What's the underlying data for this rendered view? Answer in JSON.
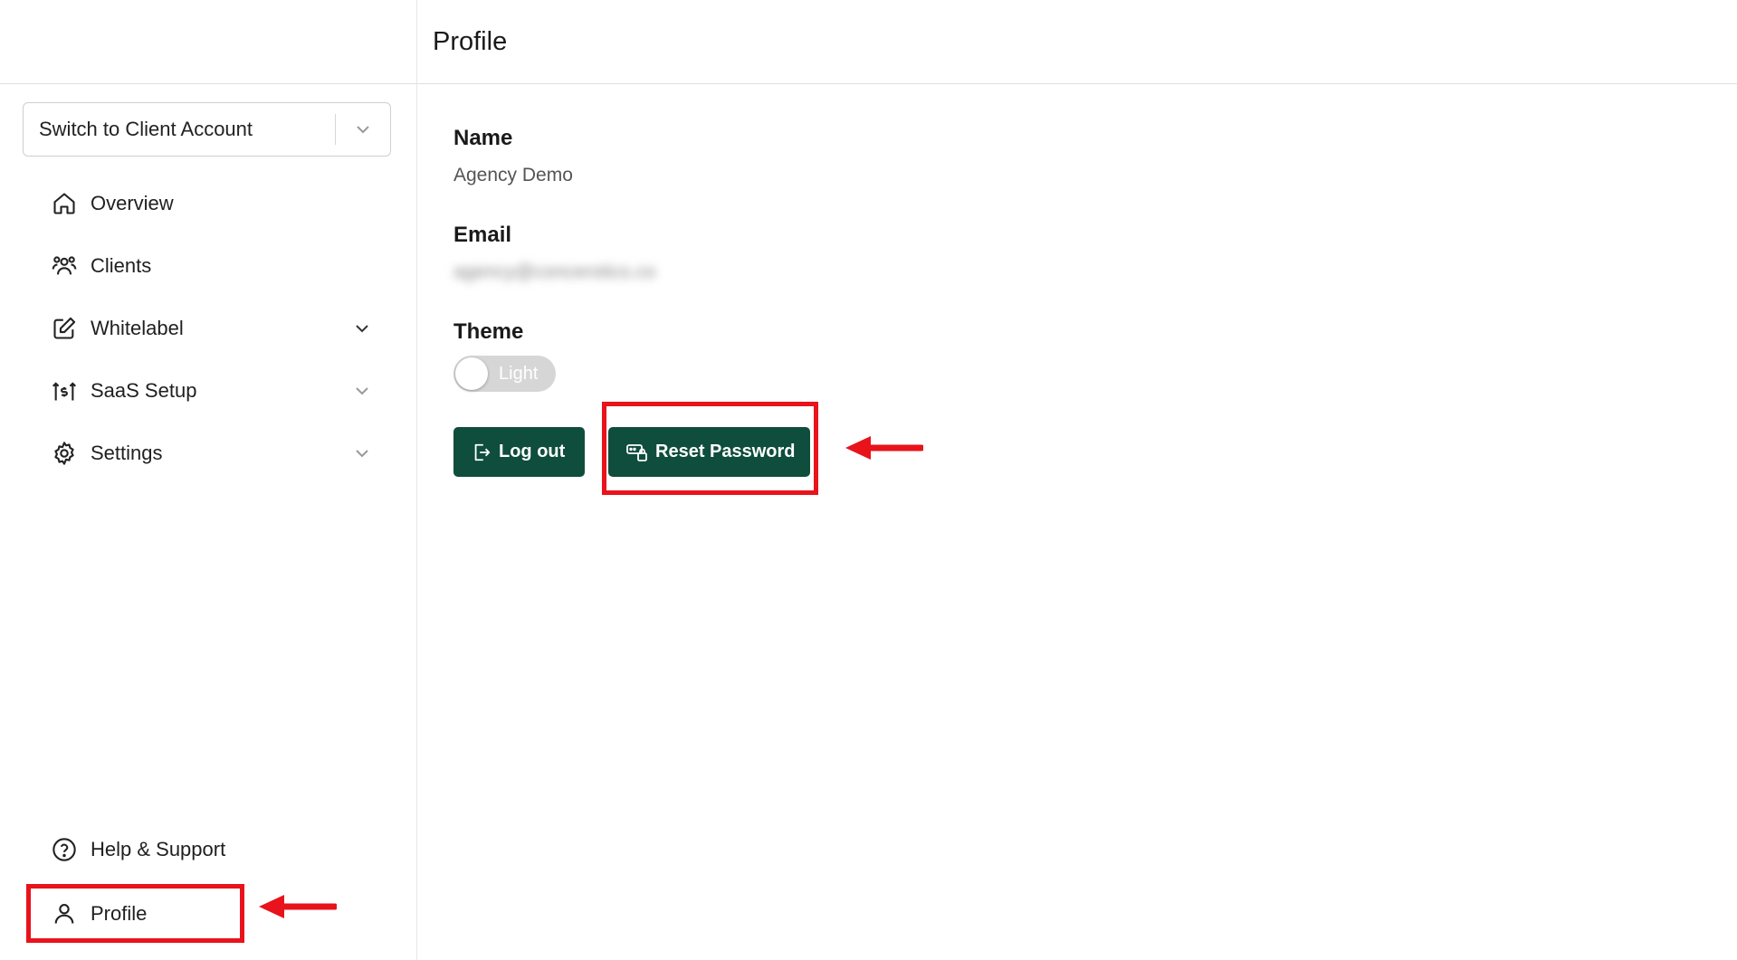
{
  "header": {
    "title": "Profile"
  },
  "sidebar": {
    "account_switch": "Switch to Client Account",
    "items": [
      {
        "label": "Overview",
        "icon": "home-icon",
        "has_chevron": false
      },
      {
        "label": "Clients",
        "icon": "users-icon",
        "has_chevron": false
      },
      {
        "label": "Whitelabel",
        "icon": "edit-icon",
        "has_chevron": true
      },
      {
        "label": "SaaS Setup",
        "icon": "saas-icon",
        "has_chevron": true
      },
      {
        "label": "Settings",
        "icon": "gear-icon",
        "has_chevron": true
      }
    ],
    "help_label": "Help & Support",
    "profile_label": "Profile"
  },
  "profile": {
    "name_label": "Name",
    "name_value": "Agency Demo",
    "email_label": "Email",
    "email_value": "agency@concerotics.co",
    "theme_label": "Theme",
    "theme_value": "Light",
    "logout_label": "Log out",
    "reset_label": "Reset Password"
  },
  "colors": {
    "primary_button": "#0f4d3c",
    "annotation_red": "#e8131b",
    "toggle_track": "#d6d6d6"
  }
}
